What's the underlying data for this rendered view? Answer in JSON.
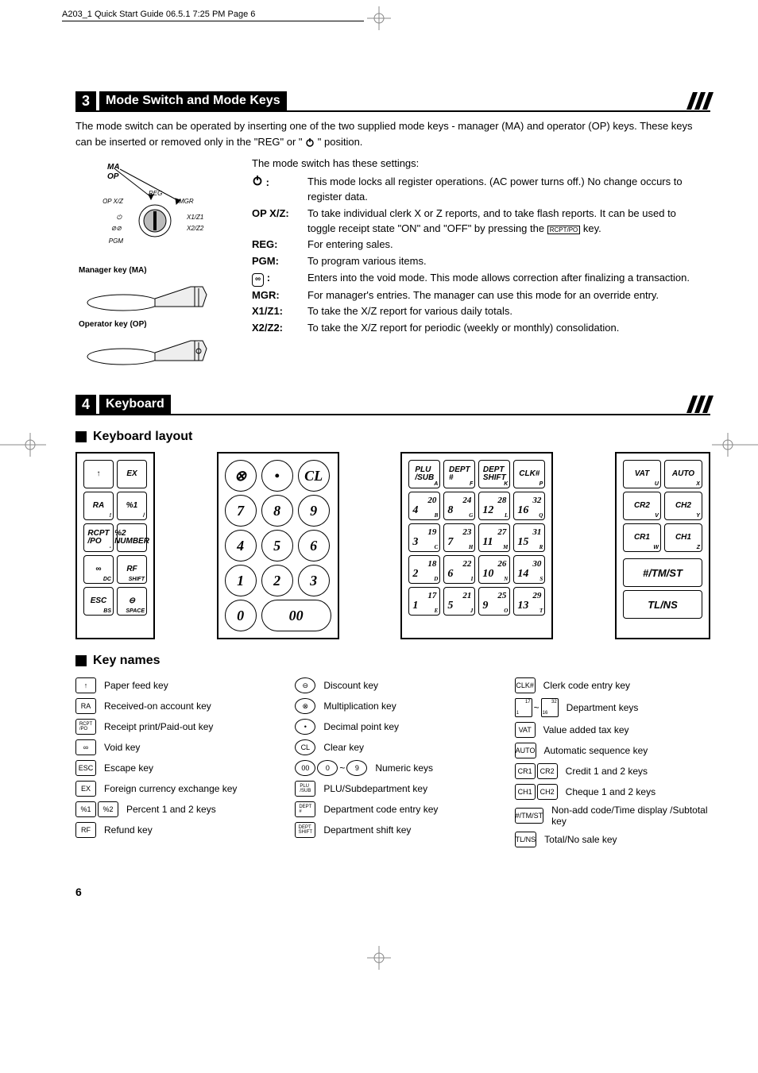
{
  "slug": "A203_1 Quick Start Guide  06.5.1 7:25 PM  Page 6",
  "page_number": "6",
  "section3": {
    "num": "3",
    "title": "Mode Switch and Mode Keys",
    "intro": "The mode switch can be operated by inserting one of the two supplied mode keys - manager (MA) and operator (OP) keys.  These keys can be inserted or removed only in the \"REG\" or \" ",
    "intro_end": " \" position.",
    "diagram": {
      "ma": "MA",
      "op": "OP",
      "reg": "REG",
      "opxz": "OP X/Z",
      "mgr": "MGR",
      "x1z1": "X1/Z1",
      "void": "⊘⊘",
      "x2z2": "X2/Z2",
      "pgm": "PGM",
      "mkey": "Manager key (MA)",
      "okey": "Operator key (OP)"
    },
    "lead": "The mode switch has these settings:",
    "rows": [
      {
        "k": "⏻ :",
        "v": "This mode locks all register operations. (AC power turns off.) No change occurs to register data."
      },
      {
        "k": "OP X/Z:",
        "v": "To take individual clerk X or Z reports, and to take flash reports. It can be used to toggle receipt state \"ON\" and \"OFF\" by pressing the ",
        "v2": " key."
      },
      {
        "k": "REG:",
        "v": "For entering sales."
      },
      {
        "k": "PGM:",
        "v": "To program various items."
      },
      {
        "k": "void",
        "v": "Enters into the void mode.  This mode allows correction after finalizing a transaction."
      },
      {
        "k": "MGR:",
        "v": "For manager's entries.  The manager can use this mode for an override entry."
      },
      {
        "k": "X1/Z1:",
        "v": "To take the X/Z report for various daily totals."
      },
      {
        "k": "X2/Z2:",
        "v": "To take the X/Z report for periodic (weekly or monthly) consolidation."
      }
    ]
  },
  "section4": {
    "num": "4",
    "title": "Keyboard",
    "sub1": "Keyboard layout",
    "sub2": "Key names",
    "col1": [
      [
        "↑",
        "EX"
      ],
      [
        "RA",
        "%1"
      ],
      [
        "RCPT /PO",
        "%2 NUMBER"
      ],
      [
        "∞",
        "RF"
      ],
      [
        "ESC",
        "⊖"
      ]
    ],
    "col1_subs": [
      [
        "",
        ""
      ],
      [
        "!",
        "/"
      ],
      [
        "-",
        ""
      ],
      [
        "DC",
        "SHIFT"
      ],
      [
        "BS",
        "SPACE"
      ]
    ],
    "numpad": [
      "⊗",
      "•",
      "CL",
      "7",
      "8",
      "9",
      "4",
      "5",
      "6",
      "1",
      "2",
      "3",
      "0",
      "00"
    ],
    "depts_hdr": [
      [
        "PLU /SUB",
        "A"
      ],
      [
        "DEPT #",
        "F"
      ],
      [
        "DEPT SHIFT",
        "K"
      ],
      [
        "CLK#",
        "P"
      ]
    ],
    "depts": [
      [
        "20",
        "4",
        "B"
      ],
      [
        "24",
        "8",
        "G"
      ],
      [
        "28",
        "12",
        "L"
      ],
      [
        "32",
        "16",
        "Q"
      ],
      [
        "19",
        "3",
        "C"
      ],
      [
        "23",
        "7",
        "H"
      ],
      [
        "27",
        "11",
        "M"
      ],
      [
        "31",
        "15",
        "R"
      ],
      [
        "18",
        "2",
        "D"
      ],
      [
        "22",
        "6",
        "I"
      ],
      [
        "26",
        "10",
        "N"
      ],
      [
        "30",
        "14",
        "S"
      ],
      [
        "17",
        "1",
        "E"
      ],
      [
        "21",
        "5",
        "J"
      ],
      [
        "25",
        "9",
        "O"
      ],
      [
        "29",
        "13",
        "T"
      ]
    ],
    "col5": [
      [
        "VAT",
        "U",
        "AUTO",
        "X"
      ],
      [
        "CR2",
        "V",
        "CH2",
        "Y"
      ],
      [
        "CR1",
        "W",
        "CH1",
        "Z"
      ]
    ],
    "col5_wide": [
      "#/TM/ST",
      "TL/NS"
    ],
    "keynames": [
      [
        {
          "i": "↑",
          "t": "Paper feed key",
          "r": false
        },
        {
          "i": "RA",
          "t": "Received-on account key",
          "r": false
        },
        {
          "i": "RCPT /PO",
          "t": "Receipt print/Paid-out key",
          "r": false,
          "sm": true
        },
        {
          "i": "∞",
          "t": "Void key",
          "r": false
        },
        {
          "i": "ESC",
          "t": "Escape key",
          "r": false
        },
        {
          "i": "EX",
          "t": "Foreign currency exchange key",
          "r": false
        },
        {
          "i": "%1|%2",
          "t": "Percent 1 and 2 keys",
          "r": false
        },
        {
          "i": "RF",
          "t": "Refund key",
          "r": false
        }
      ],
      [
        {
          "i": "⊖",
          "t": "Discount key",
          "r": true
        },
        {
          "i": "⊗",
          "t": "Multiplication key",
          "r": true
        },
        {
          "i": "•",
          "t": "Decimal point key",
          "r": true
        },
        {
          "i": "CL",
          "t": "Clear key",
          "r": true
        },
        {
          "i": "00~9",
          "t": "Numeric keys",
          "r": true,
          "range": [
            "00",
            "0",
            "9"
          ]
        },
        {
          "i": "PLU /SUB",
          "t": "PLU/Subdepartment key",
          "r": false,
          "sm": true
        },
        {
          "i": "DEPT #",
          "t": "Department code entry key",
          "r": false,
          "sm": true
        },
        {
          "i": "DEPT SHIFT",
          "t": "Department shift key",
          "r": false,
          "sm": true
        }
      ],
      [
        {
          "i": "CLK#",
          "t": "Clerk code entry key",
          "r": false
        },
        {
          "i": "deptrange",
          "t": "Department keys",
          "r": false
        },
        {
          "i": "VAT",
          "t": "Value added tax key",
          "r": false
        },
        {
          "i": "AUTO",
          "t": "Automatic sequence key",
          "r": false
        },
        {
          "i": "CR1|CR2",
          "t": "Credit 1 and 2 keys",
          "r": false
        },
        {
          "i": "CH1|CH2",
          "t": "Cheque 1 and 2 keys",
          "r": false
        },
        {
          "i": "#/TM/ST",
          "t": "Non-add code/Time display /Subtotal key",
          "r": false
        },
        {
          "i": "TL/NS",
          "t": "Total/No sale key",
          "r": false
        }
      ]
    ]
  }
}
